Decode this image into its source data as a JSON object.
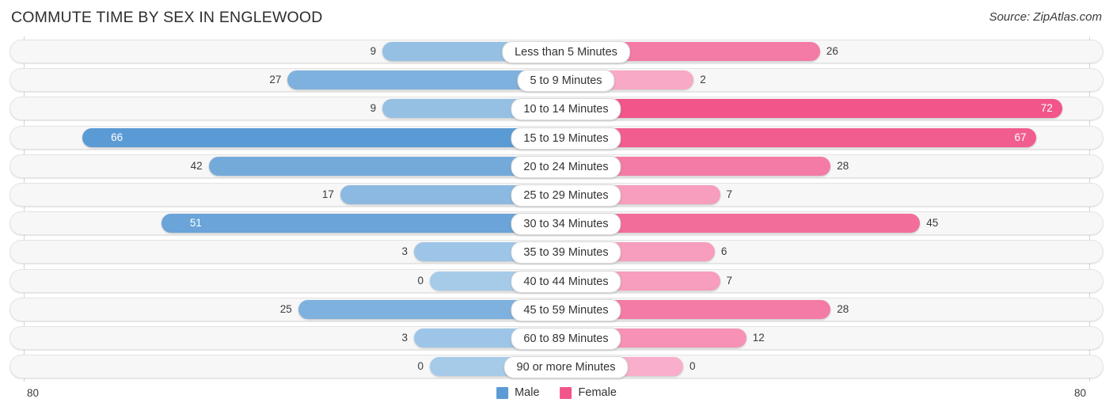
{
  "header": {
    "title": "COMMUTE TIME BY SEX IN ENGLEWOOD",
    "source": "Source: ZipAtlas.com"
  },
  "axis": {
    "left_label": "80",
    "right_label": "80",
    "max": 80
  },
  "legend": {
    "items": [
      {
        "label": "Male",
        "color": "#5b9bd5"
      },
      {
        "label": "Female",
        "color": "#f1558a"
      }
    ]
  },
  "chart_data": {
    "type": "bar",
    "orientation": "horizontal-diverging",
    "title": "COMMUTE TIME BY SEX IN ENGLEWOOD",
    "xlabel": "",
    "ylabel": "",
    "xlim": [
      80,
      80
    ],
    "grid": false,
    "legend_position": "bottom-center",
    "categories": [
      "Less than 5 Minutes",
      "5 to 9 Minutes",
      "10 to 14 Minutes",
      "15 to 19 Minutes",
      "20 to 24 Minutes",
      "25 to 29 Minutes",
      "30 to 34 Minutes",
      "35 to 39 Minutes",
      "40 to 44 Minutes",
      "45 to 59 Minutes",
      "60 to 89 Minutes",
      "90 or more Minutes"
    ],
    "series": [
      {
        "name": "Male",
        "color": "#5b9bd5",
        "values": [
          9,
          27,
          9,
          66,
          42,
          17,
          51,
          3,
          0,
          25,
          3,
          0
        ]
      },
      {
        "name": "Female",
        "color": "#f1558a",
        "values": [
          26,
          2,
          72,
          67,
          28,
          7,
          45,
          6,
          7,
          28,
          12,
          0
        ]
      }
    ]
  },
  "rows": [
    {
      "label": "Less than 5 Minutes",
      "male": "9",
      "female": "26",
      "male_color": "#95c0e4",
      "female_color": "#f47ba6",
      "male_inside": false,
      "female_inside": false
    },
    {
      "label": "5 to 9 Minutes",
      "male": "27",
      "female": "2",
      "male_color": "#7eb1de",
      "female_color": "#f8a9c6",
      "male_inside": false,
      "female_inside": false
    },
    {
      "label": "10 to 14 Minutes",
      "male": "9",
      "female": "72",
      "male_color": "#95c0e4",
      "female_color": "#f1558a",
      "male_inside": false,
      "female_inside": true
    },
    {
      "label": "15 to 19 Minutes",
      "male": "66",
      "female": "67",
      "male_color": "#5b9bd5",
      "female_color": "#f25d90",
      "male_inside": true,
      "female_inside": true
    },
    {
      "label": "20 to 24 Minutes",
      "male": "42",
      "female": "28",
      "male_color": "#74aada",
      "female_color": "#f47ba6",
      "male_inside": false,
      "female_inside": false
    },
    {
      "label": "25 to 29 Minutes",
      "male": "17",
      "female": "7",
      "male_color": "#8bb9e1",
      "female_color": "#f79dbd",
      "male_inside": false,
      "female_inside": false
    },
    {
      "label": "30 to 34 Minutes",
      "male": "51",
      "female": "45",
      "male_color": "#6aa4d8",
      "female_color": "#f36d9b",
      "male_inside": true,
      "female_inside": false
    },
    {
      "label": "35 to 39 Minutes",
      "male": "3",
      "female": "6",
      "male_color": "#9dc5e7",
      "female_color": "#f79dbd",
      "male_inside": false,
      "female_inside": false
    },
    {
      "label": "40 to 44 Minutes",
      "male": "0",
      "female": "7",
      "male_color": "#a6cbe9",
      "female_color": "#f79dbd",
      "male_inside": false,
      "female_inside": false
    },
    {
      "label": "45 to 59 Minutes",
      "male": "25",
      "female": "28",
      "male_color": "#7eb1de",
      "female_color": "#f47ba6",
      "male_inside": false,
      "female_inside": false
    },
    {
      "label": "60 to 89 Minutes",
      "male": "3",
      "female": "12",
      "male_color": "#9dc5e7",
      "female_color": "#f792b6",
      "male_inside": false,
      "female_inside": false
    },
    {
      "label": "90 or more Minutes",
      "male": "0",
      "female": "0",
      "male_color": "#a6cbe9",
      "female_color": "#f9aecb",
      "male_inside": false,
      "female_inside": false
    }
  ]
}
